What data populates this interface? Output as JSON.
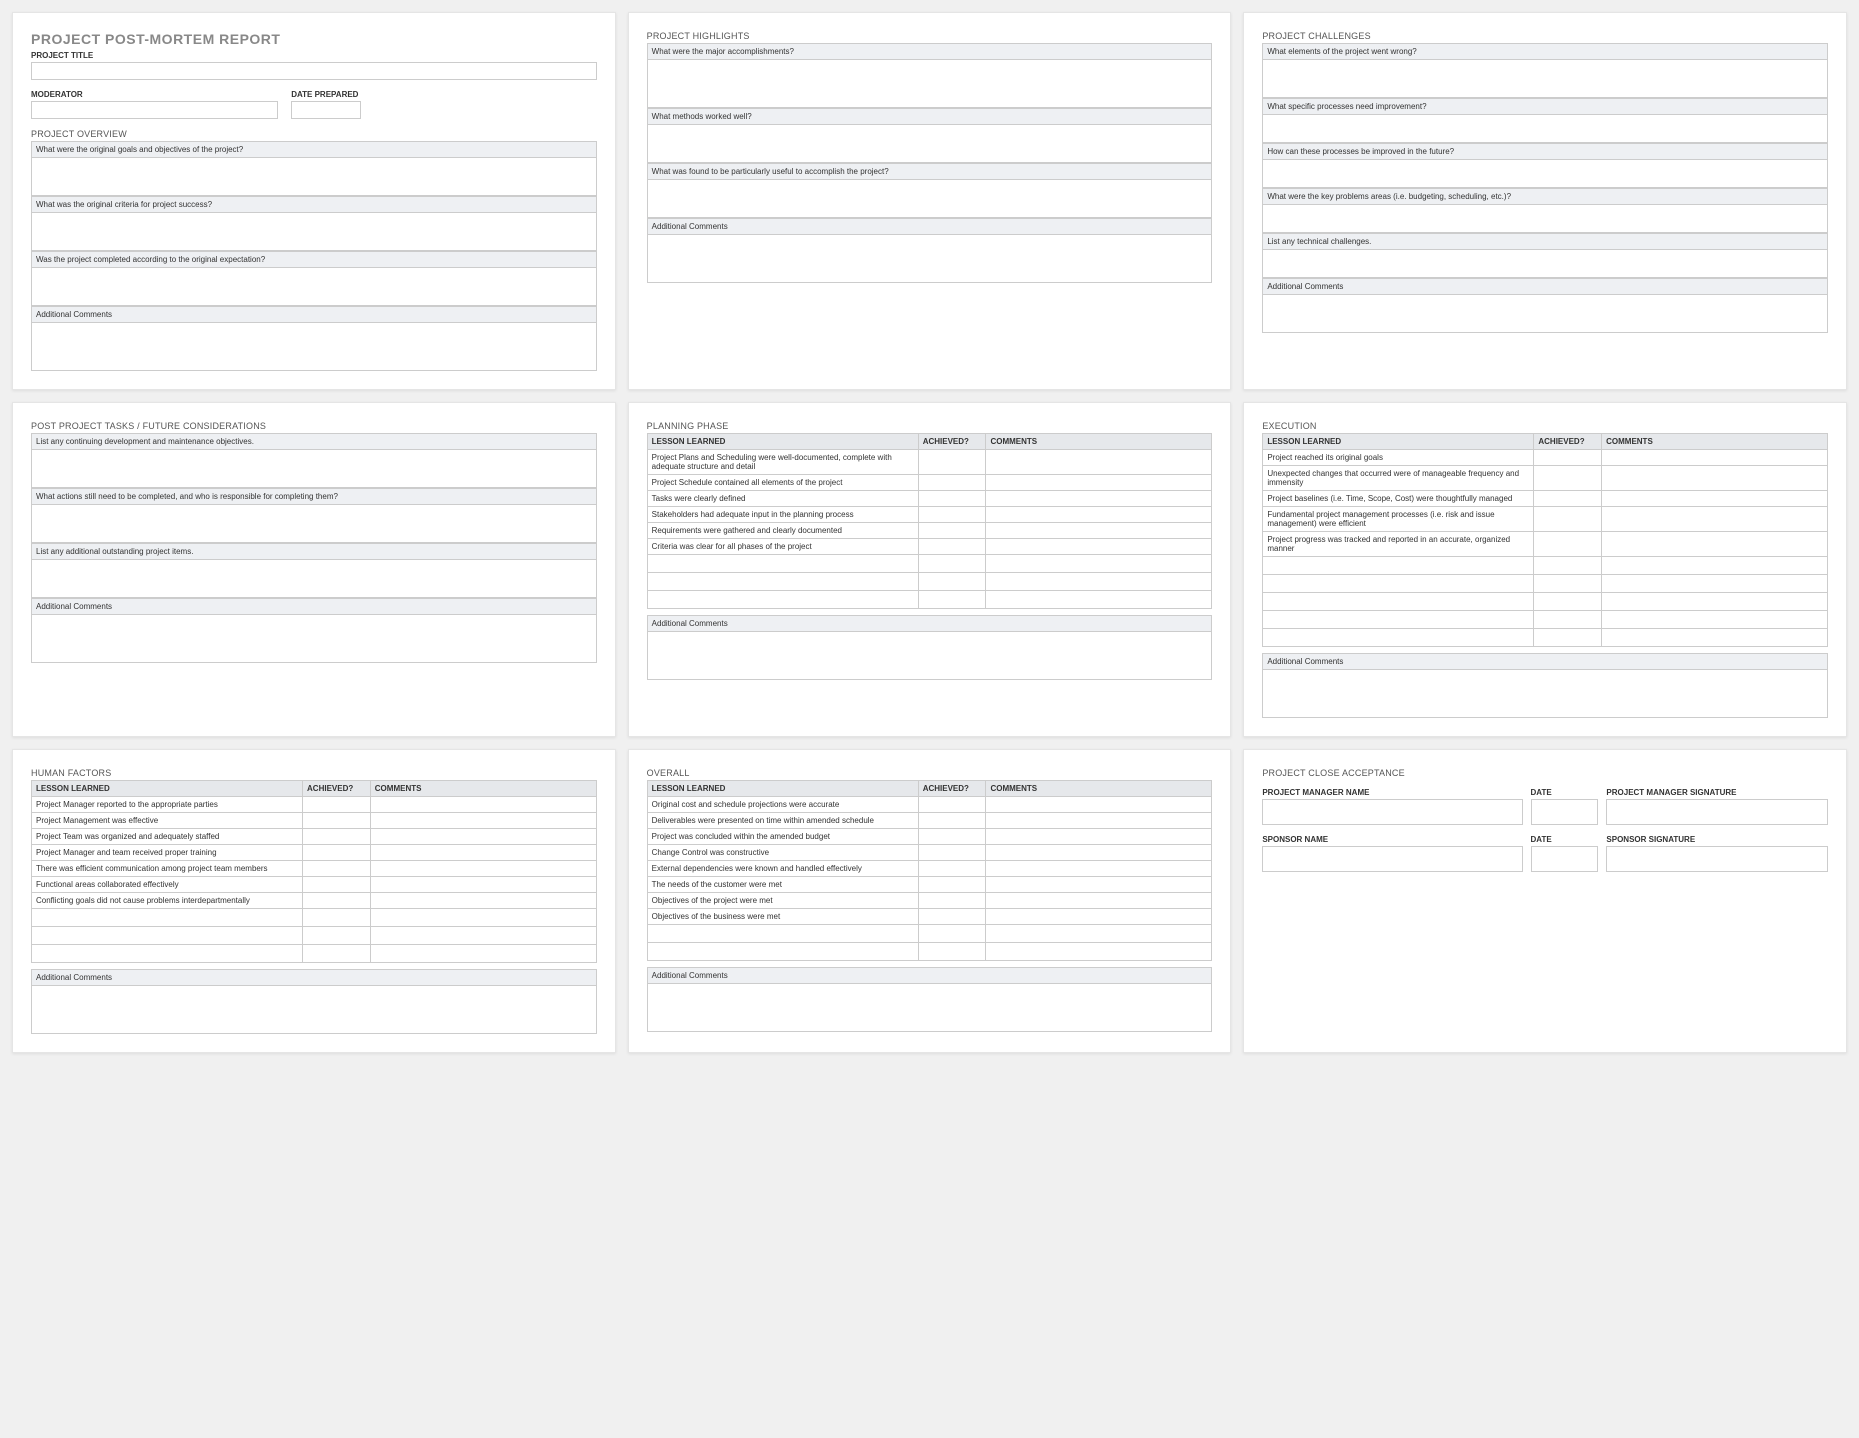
{
  "report": {
    "title": "PROJECT POST-MORTEM REPORT",
    "projectTitleLabel": "PROJECT TITLE",
    "moderatorLabel": "MODERATOR",
    "datePreparedLabel": "DATE PREPARED"
  },
  "overview": {
    "heading": "PROJECT OVERVIEW",
    "q1": "What were the original goals and objectives of the project?",
    "q2": "What was the original criteria for project success?",
    "q3": "Was the project completed according to the original expectation?",
    "commentsLabel": "Additional Comments"
  },
  "highlights": {
    "heading": "PROJECT HIGHLIGHTS",
    "q1": "What were the major accomplishments?",
    "q2": "What methods worked well?",
    "q3": "What was found to be particularly useful to accomplish the project?",
    "commentsLabel": "Additional Comments"
  },
  "challenges": {
    "heading": "PROJECT CHALLENGES",
    "q1": "What elements of the project went wrong?",
    "q2": "What specific processes need improvement?",
    "q3": "How can these processes be improved in the future?",
    "q4": "What were the key problems areas (i.e. budgeting, scheduling, etc.)?",
    "q5": "List any technical challenges.",
    "commentsLabel": "Additional Comments"
  },
  "postProject": {
    "heading": "POST PROJECT TASKS / FUTURE CONSIDERATIONS",
    "q1": "List any continuing development and maintenance objectives.",
    "q2": "What actions still need to be completed, and who is responsible for completing them?",
    "q3": "List any additional outstanding project items.",
    "commentsLabel": "Additional Comments"
  },
  "tableHeaders": {
    "lesson": "LESSON LEARNED",
    "achieved": "ACHIEVED?",
    "comments": "COMMENTS"
  },
  "planning": {
    "heading": "PLANNING PHASE",
    "rows": [
      "Project Plans and Scheduling were well-documented, complete with adequate structure and detail",
      "Project Schedule contained all elements of the project",
      "Tasks were clearly defined",
      "Stakeholders had adequate input in the planning process",
      "Requirements were gathered and clearly documented",
      "Criteria was clear for all phases of the project"
    ],
    "blankRows": 3,
    "commentsLabel": "Additional Comments"
  },
  "execution": {
    "heading": "EXECUTION",
    "rows": [
      "Project reached its original goals",
      "Unexpected changes that occurred were of manageable frequency and immensity",
      "Project baselines (i.e. Time, Scope, Cost) were thoughtfully managed",
      "Fundamental project management processes (i.e. risk and issue management) were efficient",
      "Project progress was tracked and reported in an accurate, organized manner"
    ],
    "blankRows": 5,
    "commentsLabel": "Additional Comments"
  },
  "human": {
    "heading": "HUMAN FACTORS",
    "rows": [
      "Project Manager reported to the appropriate parties",
      "Project Management was effective",
      "Project Team was organized and adequately staffed",
      "Project Manager and team received proper training",
      "There was efficient communication among project team members",
      "Functional areas collaborated effectively",
      "Conflicting goals did not cause problems interdepartmentally"
    ],
    "blankRows": 3,
    "commentsLabel": "Additional Comments"
  },
  "overall": {
    "heading": "OVERALL",
    "rows": [
      "Original cost and schedule projections were accurate",
      "Deliverables were presented on time within amended schedule",
      "Project was concluded within the amended budget",
      "Change Control was constructive",
      "External dependencies were known and handled effectively",
      "The needs of the customer were met",
      "Objectives of the project were met",
      "Objectives of the business were met"
    ],
    "blankRows": 2,
    "commentsLabel": "Additional Comments"
  },
  "close": {
    "heading": "PROJECT CLOSE ACCEPTANCE",
    "pmName": "PROJECT MANAGER NAME",
    "date": "DATE",
    "pmSig": "PROJECT MANAGER SIGNATURE",
    "sponsorName": "SPONSOR NAME",
    "sponsorSig": "SPONSOR SIGNATURE"
  }
}
